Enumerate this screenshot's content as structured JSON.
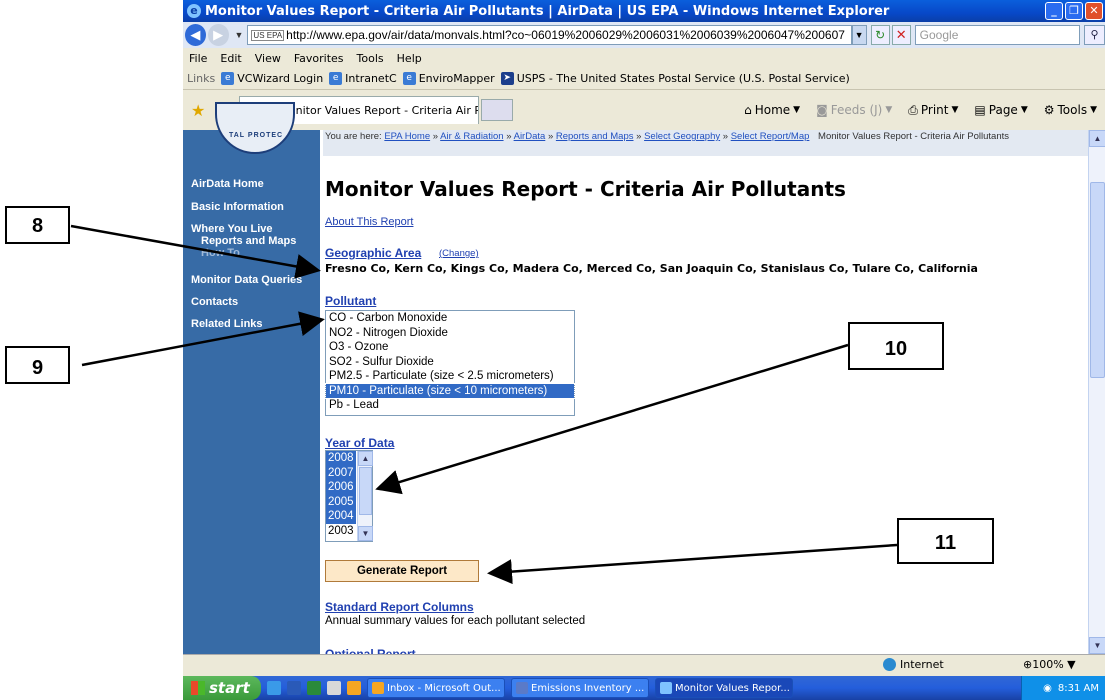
{
  "window": {
    "title": "Monitor Values Report - Criteria Air Pollutants | AirData | US EPA - Windows Internet Explorer",
    "address": "http://www.epa.gov/air/data/monvals.html?co~06019%2006029%2006031%2006039%2006047%200607",
    "address_icon": "US EPA",
    "search_placeholder": "Google"
  },
  "menu": [
    "File",
    "Edit",
    "View",
    "Favorites",
    "Tools",
    "Help"
  ],
  "links_bar": {
    "label": "Links",
    "items": [
      "VCWizard Login",
      "IntranetC",
      "EnviroMapper",
      "USPS - The United States Postal Service (U.S. Postal Service)"
    ]
  },
  "tab": {
    "title": "Monitor Values Report - Criteria Air Pollutants | AirDat..."
  },
  "command_bar": {
    "home": "Home",
    "feeds": "Feeds (J)",
    "print": "Print",
    "page": "Page",
    "tools": "Tools"
  },
  "sidebar": {
    "seal_text": "TAL PROTEC",
    "items": [
      "AirData Home",
      "Basic Information",
      "Where You Live",
      "Reports and Maps",
      "How To",
      "Monitor Data Queries",
      "Contacts",
      "Related Links"
    ]
  },
  "breadcrumb": {
    "prefix": "You are here:",
    "links": [
      "EPA Home",
      "Air & Radiation",
      "AirData",
      "Reports and Maps",
      "Select Geography",
      "Select Report/Map"
    ],
    "sep": "»",
    "current": "Monitor Values Report - Criteria Air Pollutants"
  },
  "page": {
    "title": "Monitor Values Report - Criteria Air Pollutants",
    "about_link": "About This Report",
    "geo_heading": "Geographic Area",
    "geo_change": "(Change)",
    "geo_region": "Fresno Co, Kern Co, Kings Co, Madera Co, Merced Co, San Joaquin Co, Stanislaus Co, Tulare Co, California",
    "pollutant_heading": "Pollutant",
    "pollutants": [
      "CO - Carbon Monoxide",
      "NO2 - Nitrogen Dioxide",
      "O3 - Ozone",
      "SO2 - Sulfur Dioxide",
      "PM2.5 - Particulate (size < 2.5 micrometers)",
      "PM10 - Particulate (size < 10 micrometers)",
      "Pb - Lead"
    ],
    "selected_pollutant": "PM10 - Particulate (size < 10 micrometers)",
    "year_heading": "Year of Data",
    "years": [
      "2008",
      "2007",
      "2006",
      "2005",
      "2004",
      "2003"
    ],
    "selected_years": [
      "2008",
      "2007",
      "2006",
      "2005",
      "2004"
    ],
    "generate_button": "Generate Report",
    "std_heading": "Standard Report Columns",
    "std_desc": "Annual summary values for each pollutant selected",
    "next_heading_peek": "Optional Report Columns"
  },
  "status": {
    "zone": "Internet",
    "zoom": "100%"
  },
  "taskbar": {
    "start": "start",
    "tasks": [
      "Inbox - Microsoft Out...",
      "Emissions Inventory ...",
      "Monitor Values Repor..."
    ],
    "clock": "8:31 AM"
  },
  "annotations": [
    "8",
    "9",
    "10",
    "11"
  ],
  "colors": {
    "sidebar": "#376ba6",
    "selection": "#316ac5",
    "title_bar": "#0a5fdc",
    "button_bg": "#fde8c8"
  }
}
